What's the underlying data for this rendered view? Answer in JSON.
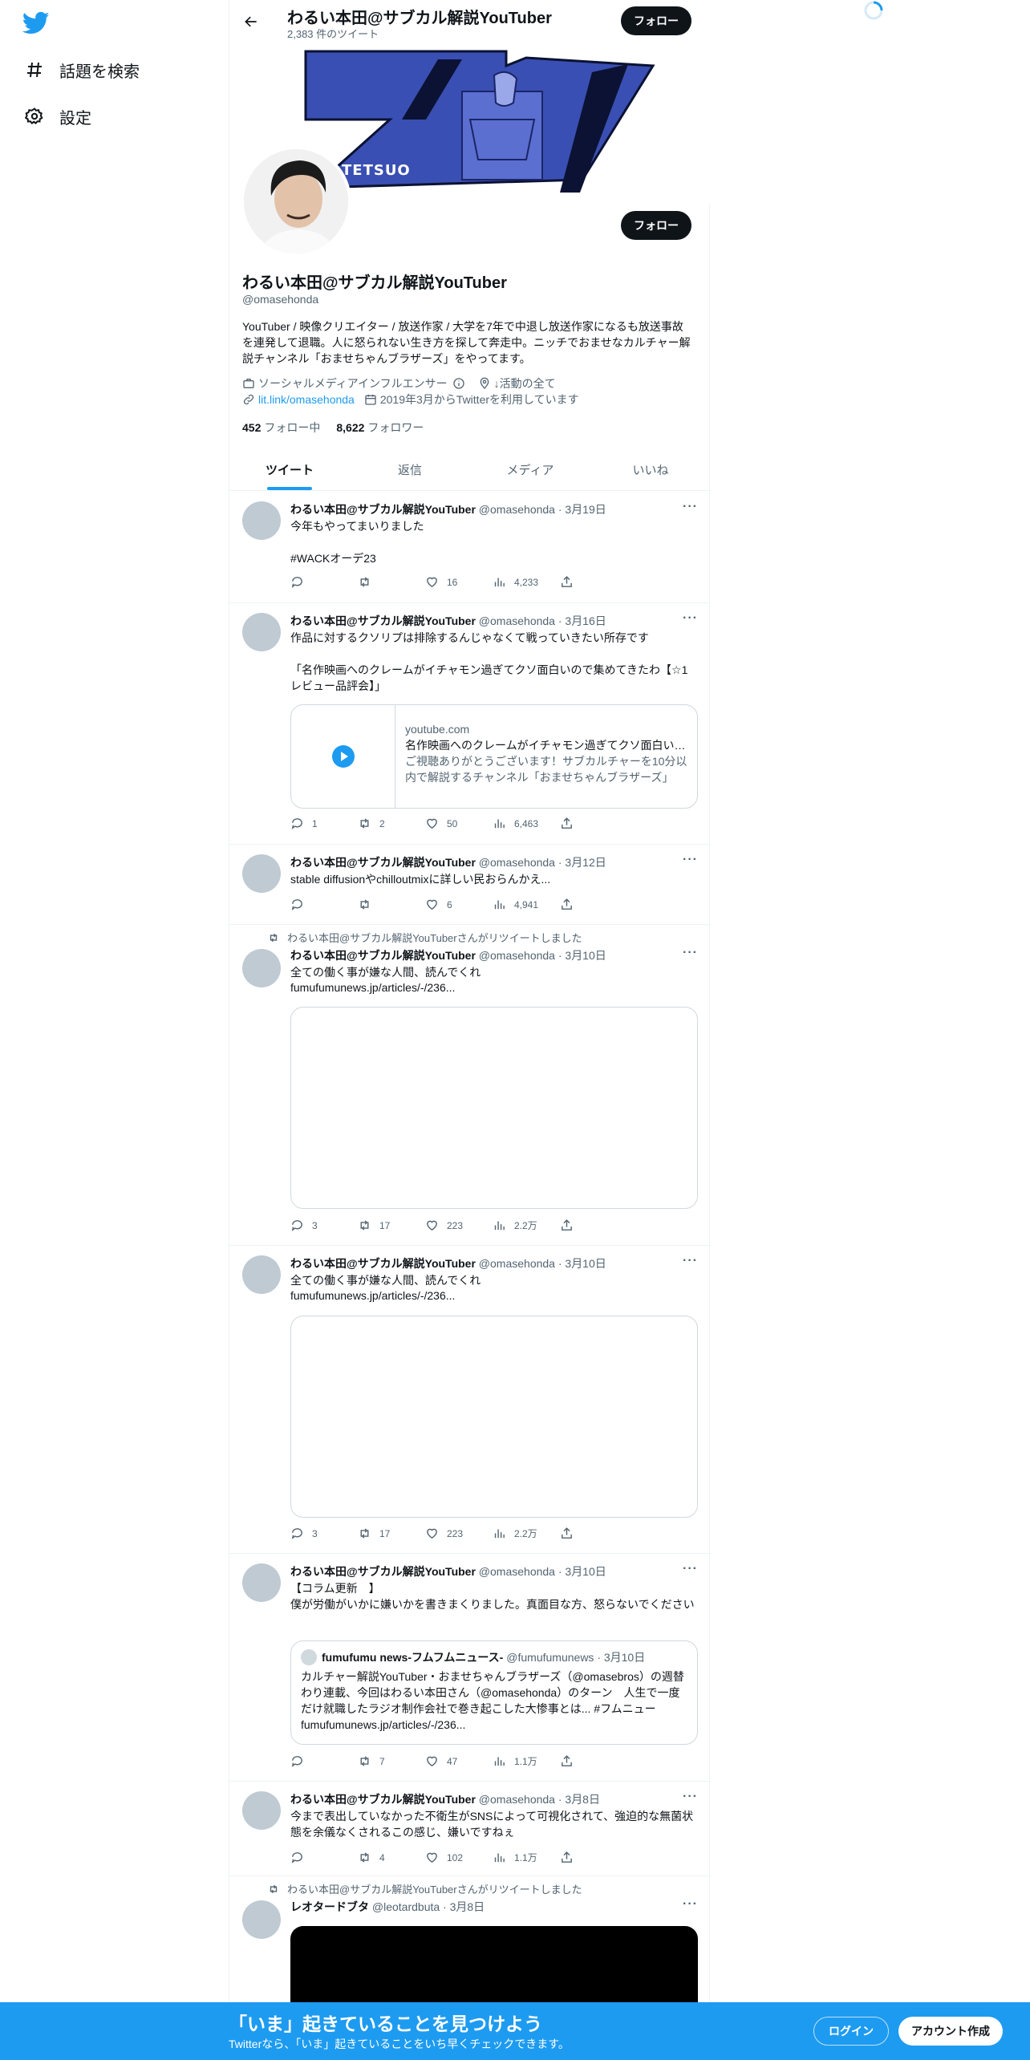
{
  "sidebar": {
    "logo_icon": "twitter-bird-icon",
    "items": [
      {
        "label": "話題を検索",
        "icon": "hashtag-icon"
      },
      {
        "label": "設定",
        "icon": "gear-icon"
      }
    ]
  },
  "header": {
    "name": "わるい本田@サブカル解説YouTuber",
    "tweet_count": "2,383 件のツイート",
    "follow_label": "フォロー"
  },
  "banner": {
    "text": "TETSUO"
  },
  "profile": {
    "follow_label": "フォロー",
    "name": "わるい本田@サブカル解説YouTuber",
    "handle": "@omasehonda",
    "bio": "YouTuber / 映像クリエイター / 放送作家 /  大学を7年で中退し放送作家になるも放送事故を連発して退職。人に怒られない生き方を探して奔走中。ニッチでおませなカルチャー解説チャンネル「おませちゃんブラザーズ」をやってます。",
    "category": "ソーシャルメディアインフルエンサー",
    "location": "↓活動の全て",
    "url": "lit.link/omasehonda",
    "joined": "2019年3月からTwitterを利用しています",
    "following_count": "452",
    "following_label": "フォロー中",
    "followers_count": "8,622",
    "followers_label": "フォロワー"
  },
  "tabs": [
    {
      "label": "ツイート",
      "active": true
    },
    {
      "label": "返信",
      "active": false
    },
    {
      "label": "メディア",
      "active": false
    },
    {
      "label": "いいね",
      "active": false
    }
  ],
  "tweets": [
    {
      "name": "わるい本田@サブカル解説YouTuber",
      "meta": "@omasehonda · 3月19日",
      "text": "今年もやってまいりました",
      "hashtag": "#WACKオーデ23",
      "reply": "",
      "retweet": "",
      "like": "16",
      "views": "4,233"
    },
    {
      "name": "わるい本田@サブカル解説YouTuber",
      "meta": "@omasehonda · 3月16日",
      "text": "作品に対するクソリプは排除するんじゃなくて戦っていきたい所存です",
      "text2": "「名作映画へのクレームがイチャモン過ぎてクソ面白いので集めてきたわ【☆1レビュー品評会】」",
      "card_domain": "youtube.com",
      "card_title": "名作映画へのクレームがイチャモン過ぎてクソ面白いので集めてきたわ【☆1レビュー品評会】",
      "card_desc": "ご視聴ありがとうございます！サブカルチャーを10分以内で解説するチャンネル「おませちゃんブラザーズ」",
      "reply": "1",
      "retweet": "2",
      "like": "50",
      "views": "6,463"
    },
    {
      "name": "わるい本田@サブカル解説YouTuber",
      "meta": "@omasehonda · 3月12日",
      "text": "stable diffusionやchilloutmixに詳しい民おらんかえ...",
      "reply": "",
      "retweet": "",
      "like": "6",
      "views": "4,941"
    },
    {
      "retweet_label": "わるい本田@サブカル解説YouTuberさんがリツイートしました",
      "name": "わるい本田@サブカル解説YouTuber",
      "meta": "@omasehonda · 3月10日",
      "text": "全ての働く事が嫌な人間、読んでくれ",
      "link": "fumufumunews.jp/articles/-/236...",
      "reply": "3",
      "retweet": "17",
      "like": "223",
      "views": "2.2万"
    },
    {
      "name": "わるい本田@サブカル解説YouTuber",
      "meta": "@omasehonda · 3月10日",
      "text": "全ての働く事が嫌な人間、読んでくれ",
      "link": "fumufumunews.jp/articles/-/236...",
      "reply": "3",
      "retweet": "17",
      "like": "223",
      "views": "2.2万"
    },
    {
      "name": "わるい本田@サブカル解説YouTuber",
      "meta": "@omasehonda · 3月10日",
      "text": "【コラム更新　】\n僕が労働がいかに嫌いかを書きまくりました。真面目な方、怒らないでください",
      "quote_name": "fumufumu news-フムフムニュース-",
      "quote_meta": "@fumufumunews · 3月10日",
      "quote_text": "カルチャー解説YouTuber・おませちゃんブラザーズ（@omasebros）の週替わり連載、今回はわるい本田さん（@omasehonda）のターン　人生で一度だけ就職したラジオ制作会社で巻き起こした大惨事とは... #フムニュー fumufumunews.jp/articles/-/236...",
      "reply": "",
      "retweet": "7",
      "like": "47",
      "views": "1.1万"
    },
    {
      "name": "わるい本田@サブカル解説YouTuber",
      "meta": "@omasehonda · 3月8日",
      "text": "今まで表出していなかった不衛生がSNSによって可視化されて、強迫的な無菌状態を余儀なくされるこの感じ、嫌いですねぇ",
      "reply": "",
      "retweet": "4",
      "like": "102",
      "views": "1.1万"
    },
    {
      "retweet_label": "わるい本田@サブカル解説YouTuberさんがリツイートしました",
      "name": "レオタードブタ",
      "meta": "@leotardbuta · 3月8日"
    }
  ],
  "bottombar": {
    "title": "「いま」起きていることを見つけよう",
    "subtitle": "Twitterなら、「いま」起きていることをいち早くチェックできます。",
    "login_label": "ログイン",
    "signup_label": "アカウント作成"
  },
  "colors": {
    "accent": "#1d9bf0",
    "text": "#0f1419",
    "secondary": "#536471",
    "banner_blue": "#3a4fb3"
  }
}
